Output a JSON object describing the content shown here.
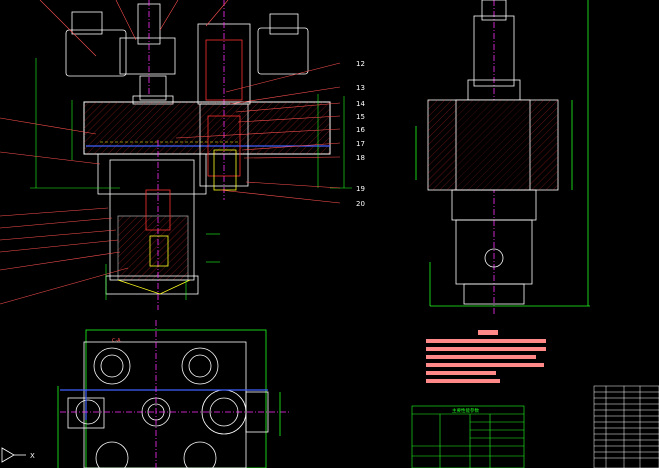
{
  "window": {
    "background": "#000000"
  },
  "colors": {
    "outline": "#ffffff",
    "dimension": "#20ff20",
    "centerline": "#ff30ff",
    "leader": "#ff5050",
    "hatch": "#ff3030",
    "notes_bar": "#ff8888",
    "blue_line": "#4060ff",
    "yellow": "#ffff20",
    "cyan": "#20ffff"
  },
  "part_numbers": [
    "12",
    "13",
    "14",
    "15",
    "16",
    "17",
    "18",
    "19",
    "20"
  ],
  "ucs_icon": {
    "name": "ucs-icon",
    "axis_x_label": "X"
  },
  "section_label": "C-A",
  "tech_requirements": {
    "title_bar": "",
    "lines": [
      "",
      "",
      "",
      "",
      "",
      "",
      ""
    ]
  },
  "param_table": {
    "title": "主要性能参数",
    "rows": [
      [
        "",
        "",
        "",
        ""
      ],
      [
        "",
        "",
        "",
        ""
      ],
      [
        "",
        "",
        "",
        ""
      ],
      [
        "",
        "",
        "",
        ""
      ],
      [
        "",
        "",
        "",
        ""
      ],
      [
        "",
        "",
        "",
        ""
      ]
    ]
  },
  "title_block": {
    "present": true
  }
}
